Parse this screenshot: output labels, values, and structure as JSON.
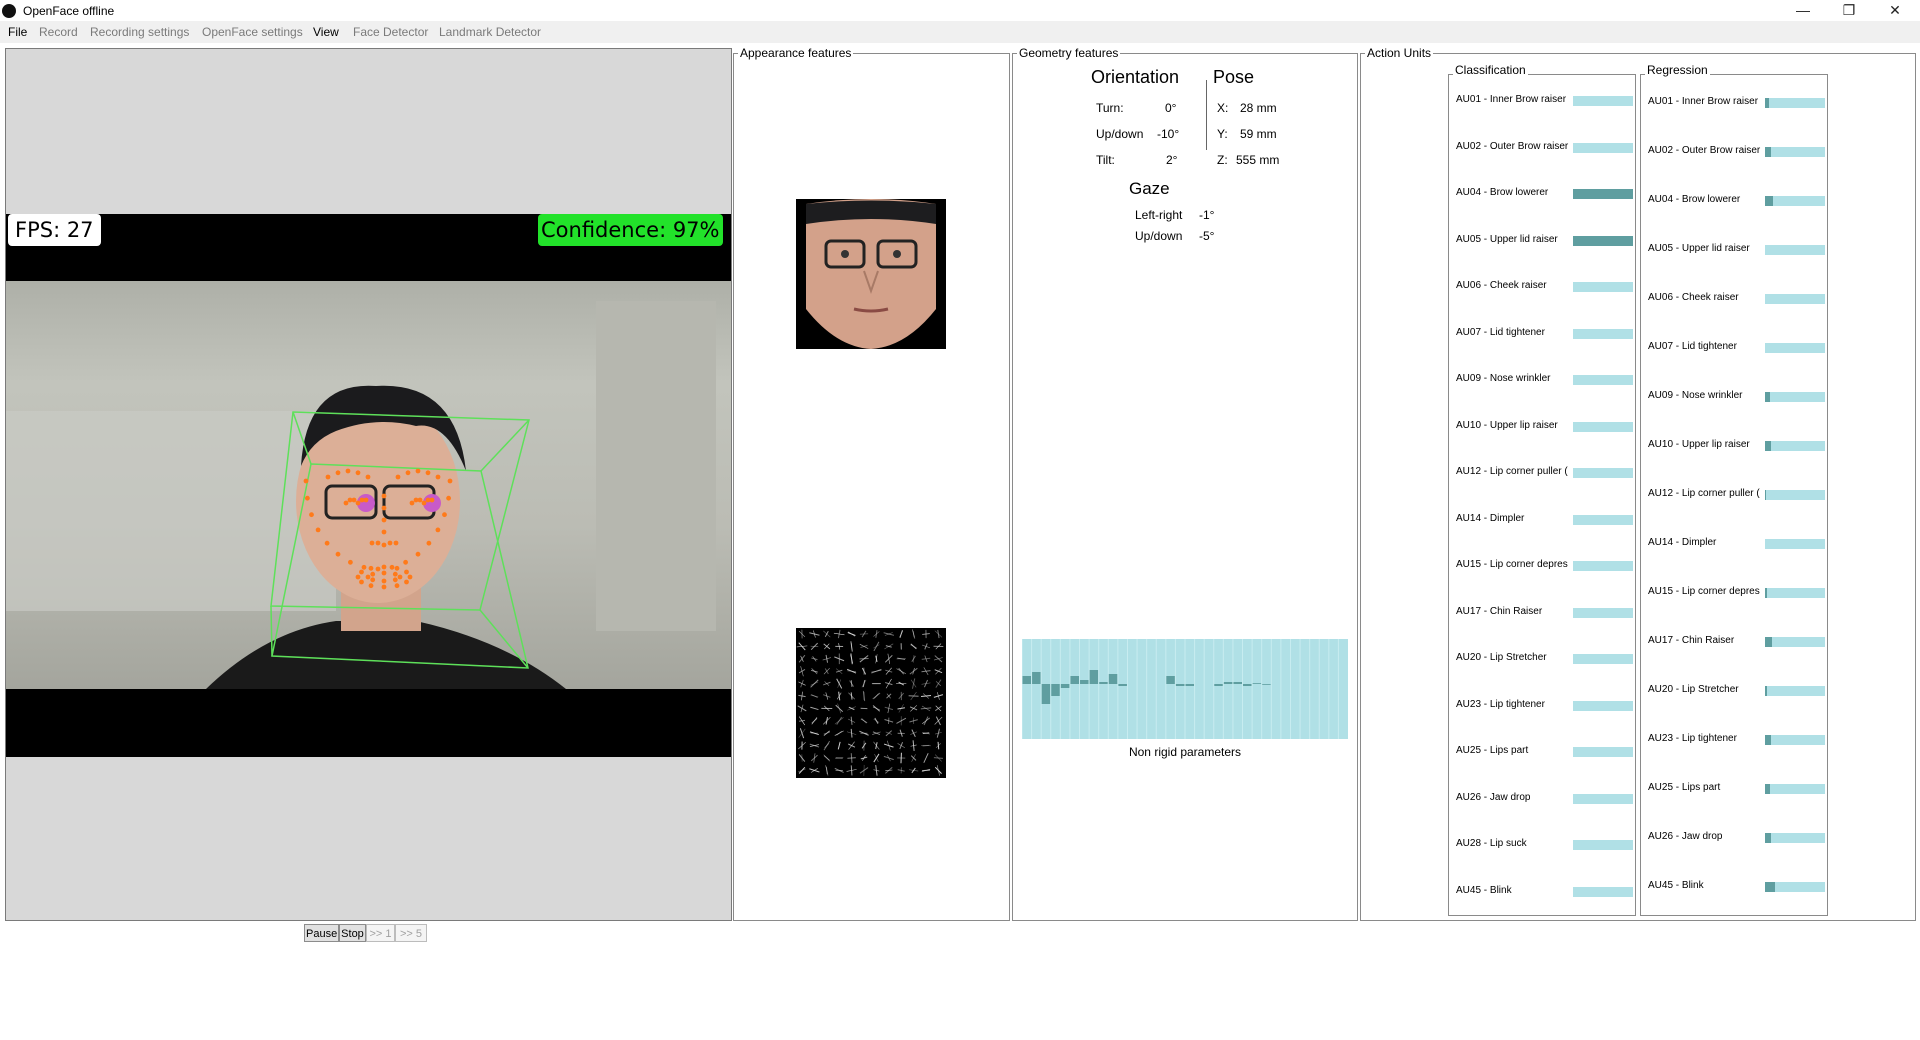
{
  "window": {
    "title": "OpenFace offline",
    "controls": {
      "minimize": "—",
      "maximize": "❐",
      "close": "✕"
    }
  },
  "menu": [
    "File",
    "Record",
    "Recording settings",
    "OpenFace settings",
    "View",
    "Face Detector",
    "Landmark Detector"
  ],
  "video": {
    "fps_text": "FPS: 27",
    "confidence_text": "Confidence: 97%"
  },
  "playback": {
    "pause": "Pause",
    "stop": "Stop",
    "step1": ">> 1",
    "step5": ">> 5"
  },
  "appearance": {
    "title": "Appearance features"
  },
  "geometry": {
    "title": "Geometry features",
    "orientation": {
      "heading": "Orientation",
      "turn_label": "Turn:",
      "turn_value": "0°",
      "updown_label": "Up/down",
      "updown_value": "-10°",
      "tilt_label": "Tilt:",
      "tilt_value": "2°"
    },
    "pose": {
      "heading": "Pose",
      "x_label": "X:",
      "x_value": "28 mm",
      "y_label": "Y:",
      "y_value": "59 mm",
      "z_label": "Z:",
      "z_value": "555 mm"
    },
    "gaze": {
      "heading": "Gaze",
      "lr_label": "Left-right",
      "lr_value": "-1°",
      "ud_label": "Up/down",
      "ud_value": "-5°"
    },
    "nonrigid_label": "Non rigid parameters",
    "nonrigid_values": [
      0.2,
      0.3,
      -0.5,
      -0.3,
      -0.1,
      0.2,
      0.1,
      0.35,
      0.05,
      0.25,
      -0.05,
      0.0,
      0.0,
      0.0,
      0.0,
      0.2,
      -0.05,
      -0.05,
      0.0,
      0.0,
      -0.05,
      0.05,
      0.05,
      -0.05,
      0.02,
      -0.02,
      0.0,
      0.0,
      0.0,
      0.0,
      0.0,
      0.0,
      0.0,
      0.0
    ]
  },
  "action_units": {
    "title": "Action Units",
    "classification_title": "Classification",
    "regression_title": "Regression",
    "classification": [
      {
        "label": "AU01 - Inner Brow raiser",
        "value": 0
      },
      {
        "label": "AU02 - Outer Brow raiser",
        "value": 0
      },
      {
        "label": "AU04 - Brow lowerer",
        "value": 1
      },
      {
        "label": "AU05 - Upper lid raiser",
        "value": 1
      },
      {
        "label": "AU06 - Cheek raiser",
        "value": 0
      },
      {
        "label": "AU07 - Lid tightener",
        "value": 0
      },
      {
        "label": "AU09 - Nose wrinkler",
        "value": 0
      },
      {
        "label": "AU10 - Upper lip raiser",
        "value": 0
      },
      {
        "label": "AU12 - Lip corner puller (",
        "value": 0
      },
      {
        "label": "AU14 - Dimpler",
        "value": 0
      },
      {
        "label": "AU15 - Lip corner depres",
        "value": 0
      },
      {
        "label": "AU17 - Chin Raiser",
        "value": 0
      },
      {
        "label": "AU20 - Lip Stretcher",
        "value": 0
      },
      {
        "label": "AU23 - Lip tightener",
        "value": 0
      },
      {
        "label": "AU25 - Lips part",
        "value": 0
      },
      {
        "label": "AU26 - Jaw drop",
        "value": 0
      },
      {
        "label": "AU28 - Lip suck",
        "value": 0
      },
      {
        "label": "AU45 - Blink",
        "value": 0
      }
    ],
    "regression": [
      {
        "label": "AU01 - Inner Brow raiser",
        "value": 0.06
      },
      {
        "label": "AU02 - Outer Brow raiser",
        "value": 0.1
      },
      {
        "label": "AU04 - Brow lowerer",
        "value": 0.14
      },
      {
        "label": "AU05 - Upper lid raiser",
        "value": 0.0
      },
      {
        "label": "AU06 - Cheek raiser",
        "value": 0.0
      },
      {
        "label": "AU07 - Lid tightener",
        "value": 0.0
      },
      {
        "label": "AU09 - Nose wrinkler",
        "value": 0.08
      },
      {
        "label": "AU10 - Upper lip raiser",
        "value": 0.1
      },
      {
        "label": "AU12 - Lip corner puller (",
        "value": 0.02
      },
      {
        "label": "AU14 - Dimpler",
        "value": 0.0
      },
      {
        "label": "AU15 - Lip corner depres",
        "value": 0.04
      },
      {
        "label": "AU17 - Chin Raiser",
        "value": 0.12
      },
      {
        "label": "AU20 - Lip Stretcher",
        "value": 0.04
      },
      {
        "label": "AU23 - Lip tightener",
        "value": 0.1
      },
      {
        "label": "AU25 - Lips part",
        "value": 0.08
      },
      {
        "label": "AU26 - Jaw drop",
        "value": 0.1
      },
      {
        "label": "AU45 - Blink",
        "value": 0.16
      }
    ]
  },
  "colors": {
    "bar_background": "#b0e0e6",
    "bar_fill": "#5f9ea0",
    "confidence_bg": "#22e22a",
    "landmark": "#ff7a1a",
    "box": "#5ee05a"
  }
}
